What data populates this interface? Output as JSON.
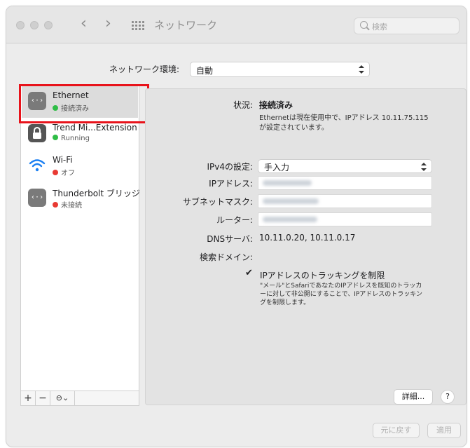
{
  "window": {
    "title": "ネットワーク",
    "search_placeholder": "検索"
  },
  "location": {
    "label": "ネットワーク環境:",
    "value": "自動"
  },
  "services": [
    {
      "name": "Ethernet",
      "status": "接続済み",
      "status_color": "#2fbd46",
      "icon": "ethernet-icon"
    },
    {
      "name": "Trend Mi...Extension",
      "status": "Running",
      "status_color": "#2fbd46",
      "icon": "lock-icon"
    },
    {
      "name": "Wi-Fi",
      "status": "オフ",
      "status_color": "#e83a33",
      "icon": "wifi-icon"
    },
    {
      "name": "Thunderbolt ブリッジ",
      "status": "未接続",
      "status_color": "#e83a33",
      "icon": "ethernet-icon"
    }
  ],
  "detail": {
    "status_label": "状況:",
    "status_value": "接続済み",
    "status_desc_line1": "Ethernetは現在使用中で、IPアドレス 10.11.75.115",
    "status_desc_line2": "が設定されています。",
    "ipv4_label": "IPv4の設定:",
    "ipv4_value": "手入力",
    "ip_label": "IPアドレス:",
    "subnet_label": "サブネットマスク:",
    "router_label": "ルーター:",
    "dns_label": "DNSサーバ:",
    "dns_value": "10.11.0.20, 10.11.0.17",
    "search_domain_label": "検索ドメイン:",
    "limit_tracking_label": "IPアドレスのトラッキングを制限",
    "limit_tracking_desc_line1": "\"メール\"とSafariであなたのIPアドレスを既知のトラッカ",
    "limit_tracking_desc_line2": "ーに対して非公開にすることで、IPアドレスのトラッキン",
    "limit_tracking_desc_line3": "グを制限します。",
    "advanced_button": "詳細...",
    "help_button": "?"
  },
  "footer": {
    "revert_button": "元に戻す",
    "apply_button": "適用"
  },
  "toolbar": {
    "add": "+",
    "remove": "−",
    "action": "⊖⌄"
  },
  "colors": {
    "highlight": "#e8131b",
    "connected": "#2fbd46",
    "disconnected": "#e83a33"
  }
}
